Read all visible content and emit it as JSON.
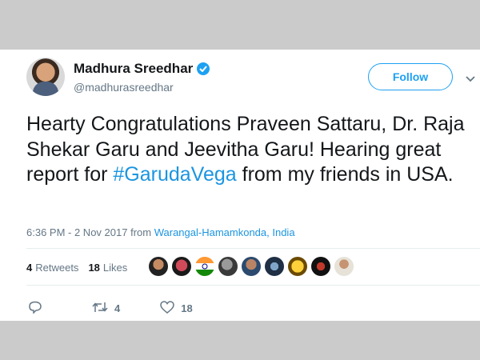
{
  "user": {
    "display_name": "Madhura Sreedhar",
    "handle": "@madhurasreedhar",
    "verified": true
  },
  "follow_button": {
    "label": "Follow"
  },
  "tweet": {
    "text_before": "Hearty Congratulations Praveen Sattaru, Dr. Raja Shekar Garu and Jeevitha Garu! Hearing great report for ",
    "hashtag": "#GarudaVega",
    "text_after": " from my friends in USA."
  },
  "meta": {
    "time": "6:36 PM - 2 Nov 2017",
    "from_label": "from",
    "location": "Warangal-Hamamkonda, India"
  },
  "stats": {
    "retweets_count": "4",
    "retweets_label": "Retweets",
    "likes_count": "18",
    "likes_label": "Likes"
  },
  "actions": {
    "retweet_count": "4",
    "like_count": "18"
  },
  "colors": {
    "accent": "#1da1f2",
    "link": "#1b95e0",
    "text": "#14171a",
    "muted": "#657786"
  }
}
